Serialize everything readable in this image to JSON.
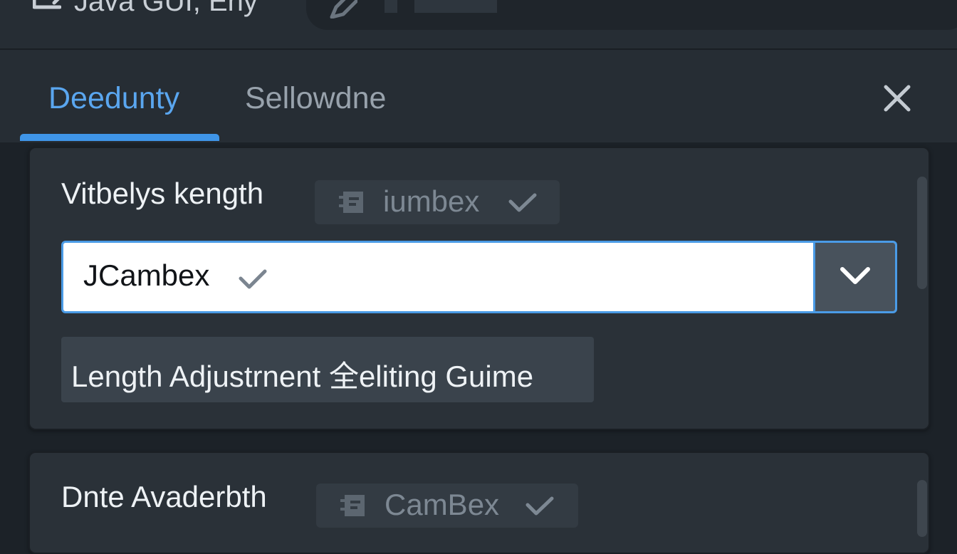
{
  "window": {
    "title": "Java GUI, Eny",
    "title_icon": "window-icon",
    "toolbar_icon": "pencil-icon"
  },
  "tabs": [
    {
      "label": "Deeduntу",
      "active": true
    },
    {
      "label": "Sellowdne",
      "active": false
    }
  ],
  "colors": {
    "accent": "#3f95e8",
    "background": "#1c2228",
    "panel": "#2a3138"
  },
  "panel_1": {
    "label": "Vitbelys kength",
    "chip": {
      "text": "iumbex",
      "icon": "calendar-icon",
      "check_icon": "check-icon"
    },
    "combo": {
      "value": "JCambex",
      "check_icon": "check-icon",
      "dropdown_icon": "chevron-down-icon"
    },
    "guide_button": "Length Adjustrnent 全eliting Guime"
  },
  "panel_2": {
    "label": "Dnte Avaderbth",
    "chip": {
      "text": "CamBex",
      "icon": "calendar-icon",
      "check_icon": "check-icon"
    }
  },
  "close_icon": "close-icon"
}
